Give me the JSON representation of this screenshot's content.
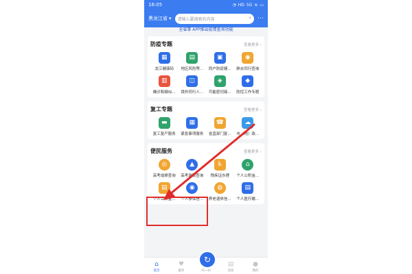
{
  "status_bar": {
    "time": "16:05",
    "icons": [
      "bell-icon",
      "hd-icon",
      "5g-icon",
      "wifi-icon",
      "battery-icon"
    ],
    "icon_glyphs": [
      "◔",
      "HD",
      "5G",
      "≋",
      "▭"
    ]
  },
  "topbar": {
    "region": "黑龙江省",
    "search_placeholder": "请输入要搜索的内容",
    "scan_glyph": "⌾",
    "more_glyph": "⋯"
  },
  "banner": {
    "text": "全省事 APP推出疫情查询功能"
  },
  "sections": [
    {
      "title": "防疫专题",
      "more": "查看更多 ›",
      "items": [
        {
          "label": "龙江健康码",
          "icon": "qr-grid-icon",
          "glyph": "▦",
          "color": "#2f6ee8"
        },
        {
          "label": "地区风险等...",
          "icon": "risk-area-icon",
          "glyph": "▤",
          "color": "#2fa36b"
        },
        {
          "label": "同户防疫健...",
          "icon": "document-icon",
          "glyph": "▣",
          "color": "#2f6ee8"
        },
        {
          "label": "肺炎同行查询",
          "icon": "travel-icon",
          "glyph": "◉",
          "color": "#f0a531"
        },
        {
          "label": "确诊和疑似...",
          "icon": "chart-icon",
          "glyph": "▥",
          "color": "#e8553d"
        },
        {
          "label": "境外同行人...",
          "icon": "people-icon",
          "glyph": "◫",
          "color": "#2f6ee8"
        },
        {
          "label": "可能密切接...",
          "icon": "contact-icon",
          "glyph": "◈",
          "color": "#2fa36b"
        },
        {
          "label": "防控工作专题",
          "icon": "shield-icon",
          "glyph": "◆",
          "color": "#2f6ee8"
        }
      ]
    },
    {
      "title": "复工专题",
      "more": "查看更多 ›",
      "items": [
        {
          "label": "复工复产服务",
          "icon": "briefcase-icon",
          "glyph": "▬",
          "color": "#2fa36b"
        },
        {
          "label": "紧急事项服务",
          "icon": "calculator-icon",
          "glyph": "▦",
          "color": "#2f6ee8"
        },
        {
          "label": "省直部门复...",
          "icon": "phone-icon",
          "glyph": "☎",
          "color": "#f0a531"
        },
        {
          "label": "市（地）政...",
          "icon": "cloud-icon",
          "glyph": "☁",
          "color": "#3b9be8"
        }
      ]
    },
    {
      "title": "便民服务",
      "more": "查看更多 ›",
      "items": [
        {
          "label": "高考成绩查询",
          "icon": "score-icon",
          "glyph": "◎",
          "color": "#f0a531",
          "round": true
        },
        {
          "label": "高考录取查询",
          "icon": "graduation-cap-icon",
          "glyph": "▲",
          "color": "#2f6ee8",
          "round": true
        },
        {
          "label": "残疾证办理",
          "icon": "wheelchair-icon",
          "glyph": "♿",
          "color": "#f0a531"
        },
        {
          "label": "个人公积金...",
          "icon": "house-icon",
          "glyph": "⌂",
          "color": "#2fa36b",
          "round": true
        },
        {
          "label": "个人公积金...",
          "icon": "fund-doc-icon",
          "glyph": "▤",
          "color": "#f0a531"
        },
        {
          "label": "个人参保信...",
          "icon": "insurance-icon",
          "glyph": "◉",
          "color": "#2f6ee8",
          "round": true
        },
        {
          "label": "养老退休信...",
          "icon": "pension-icon",
          "glyph": "◍",
          "color": "#f0a531",
          "round": true
        },
        {
          "label": "个人医疗缴...",
          "icon": "medical-doc-icon",
          "glyph": "▤",
          "color": "#2f6ee8"
        }
      ]
    }
  ],
  "tabbar": [
    {
      "label": "首页",
      "icon": "home-icon",
      "glyph": "⌂",
      "active": true
    },
    {
      "label": "服务",
      "icon": "heart-icon",
      "glyph": "♥",
      "active": false
    },
    {
      "label": "扫一扫",
      "icon": "scan-icon",
      "glyph": "",
      "active": false
    },
    {
      "label": "消息",
      "icon": "message-icon",
      "glyph": "▤",
      "active": false
    },
    {
      "label": "我的",
      "icon": "user-icon",
      "glyph": "●",
      "active": false
    }
  ],
  "fab": {
    "glyph": "↻"
  },
  "colors": {
    "primary": "#3b7cf0",
    "annotation": "#e02b2b"
  }
}
